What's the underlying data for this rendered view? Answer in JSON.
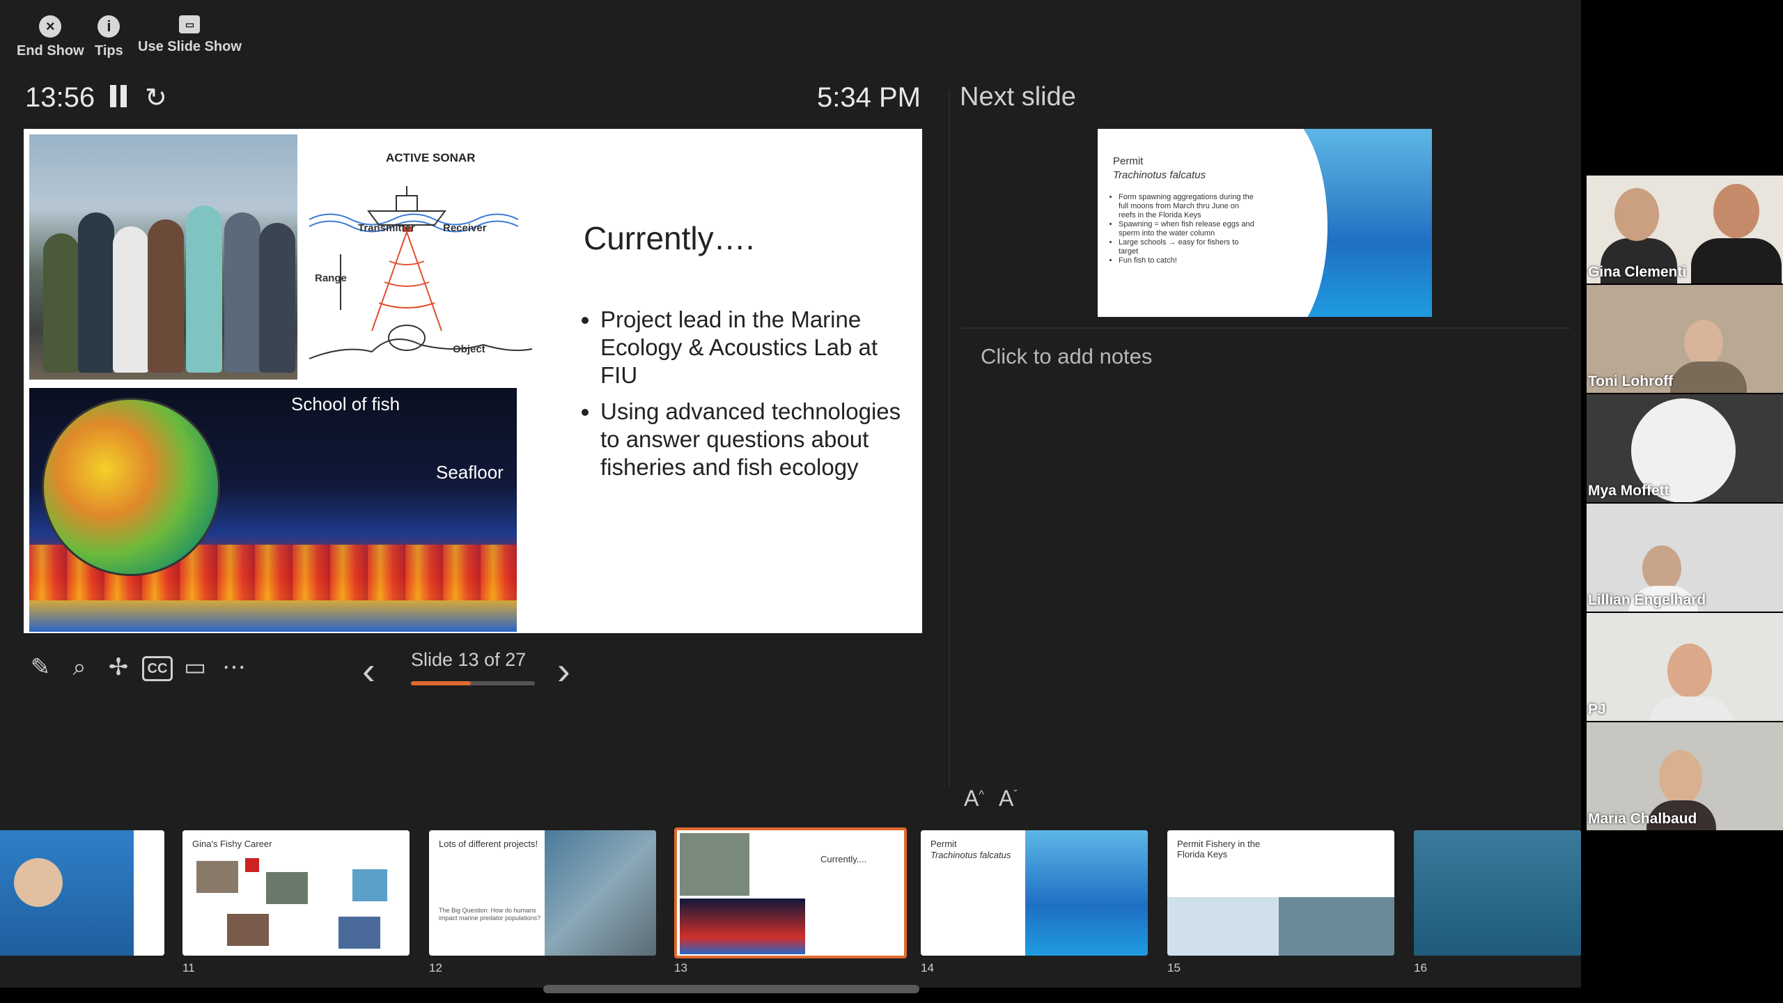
{
  "toolbar": {
    "end_show": "End Show",
    "tips": "Tips",
    "use_slide_show": "Use Slide Show"
  },
  "status": {
    "timer": "13:56",
    "clock": "5:34 PM"
  },
  "current_slide": {
    "sonar_title": "ACTIVE SONAR",
    "transmitter": "Transmitter",
    "receiver": "Receiver",
    "range": "Range",
    "object": "Object",
    "school_of_fish": "School of fish",
    "seafloor": "Seafloor",
    "heading": "Currently….",
    "bullets": [
      "Project lead in the Marine Ecology & Acoustics Lab at FIU",
      "Using advanced technologies to answer questions about fisheries and fish ecology"
    ]
  },
  "navigation": {
    "slide_counter": "Slide 13 of 27",
    "current": 13,
    "total": 27
  },
  "next_slide": {
    "label": "Next slide",
    "title": "Permit",
    "subtitle": "Trachinotus falcatus",
    "bullets": [
      "Form spawning aggregations during the full moons from March thru June on reefs in the Florida Keys",
      "Spawning = when fish release eggs and sperm into the water column",
      "Large schools → easy for fishers to target",
      "Fun fish to catch!"
    ]
  },
  "notes": {
    "placeholder": "Click to add notes"
  },
  "filmstrip": {
    "thumbs": [
      {
        "num": "11",
        "title": "Gina's Fishy Career"
      },
      {
        "num": "12",
        "title": "Lots of different projects!",
        "note": "The Big Question: How do humans impact marine predator populations?"
      },
      {
        "num": "13",
        "title": "Currently...."
      },
      {
        "num": "14",
        "title": "Permit",
        "subtitle": "Trachinotus falcatus"
      },
      {
        "num": "15",
        "title": "Permit Fishery in the Florida Keys"
      },
      {
        "num": "16"
      }
    ]
  },
  "participants": [
    {
      "name": "Gina Clementi"
    },
    {
      "name": "Toni Lohroff"
    },
    {
      "name": "Mya Moffett"
    },
    {
      "name": "Lillian Engelhard"
    },
    {
      "name": "PJ"
    },
    {
      "name": "Maria Chalbaud"
    }
  ],
  "colors": {
    "accent": "#e06a2d",
    "background": "#1e1e1e"
  }
}
